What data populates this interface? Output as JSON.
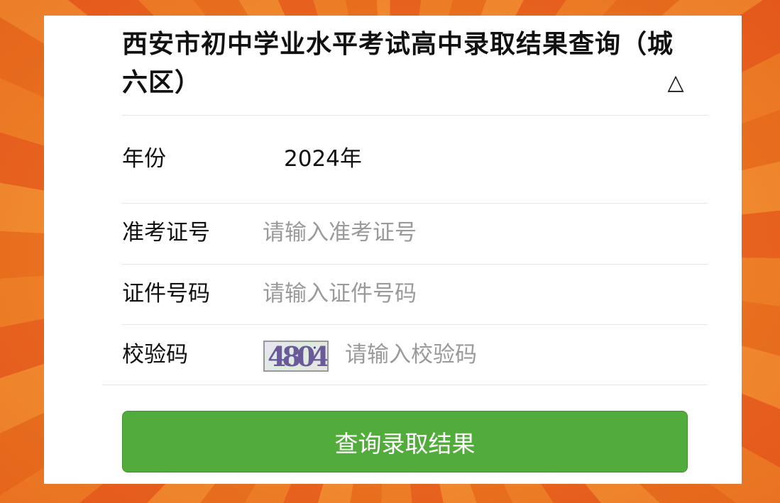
{
  "form": {
    "title": "西安市初中学业水平考试高中录取结果查询（城六区）",
    "toggle_icon": "triangle-up-icon",
    "year": {
      "label": "年份",
      "value": "2024年"
    },
    "exam_number": {
      "label": "准考证号",
      "placeholder": "请输入准考证号",
      "value": ""
    },
    "id_number": {
      "label": "证件号码",
      "placeholder": "请输入证件号码",
      "value": ""
    },
    "captcha": {
      "label": "校验码",
      "image_text": "4804",
      "placeholder": "请输入校验码",
      "value": ""
    },
    "submit_label": "查询录取结果"
  },
  "colors": {
    "button_green": "#52ac3b",
    "background_orange": "#f08a2a",
    "placeholder_gray": "#9a9a9a"
  }
}
